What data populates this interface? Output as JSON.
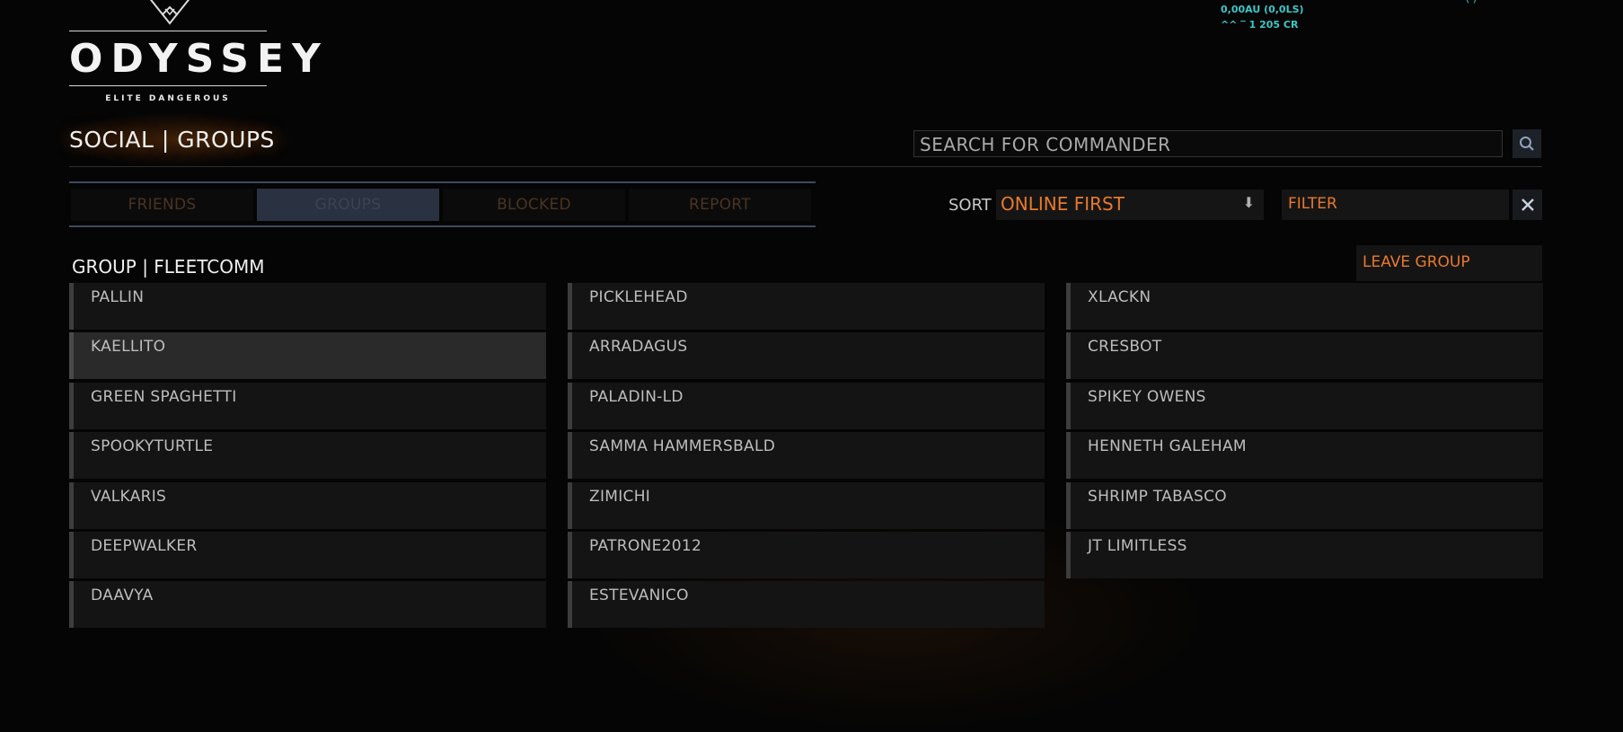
{
  "logo": {
    "title": "ODYSSEY",
    "subtitle": "ELITE DANGEROUS"
  },
  "hud": {
    "line1": "0,00AU (0,0LS)",
    "line2": "^^ ‾ 1 205 CR",
    "corner": "(   )"
  },
  "page_title": "SOCIAL | GROUPS",
  "search": {
    "placeholder": "SEARCH FOR COMMANDER",
    "icon": "search-icon"
  },
  "tabs": [
    {
      "label": "FRIENDS",
      "active": false
    },
    {
      "label": "GROUPS",
      "active": true
    },
    {
      "label": "BLOCKED",
      "active": false
    },
    {
      "label": "REPORT",
      "active": false
    }
  ],
  "sort": {
    "label": "SORT",
    "value": "ONLINE FIRST",
    "icon": "sort-arrow-icon"
  },
  "filter": {
    "placeholder": "FILTER",
    "clear_icon": "close-icon"
  },
  "group": {
    "title": "GROUP | FLEETCOMM",
    "leave_label": "LEAVE GROUP",
    "columns": [
      [
        "PALLIN",
        "KAELLITO",
        "GREEN SPAGHETTI",
        "SPOOKYTURTLE",
        "VALKARIS",
        "DEEPWALKER",
        "DAAVYA"
      ],
      [
        "PICKLEHEAD",
        "ARRADAGUS",
        "PALADIN-LD",
        "SAMMA HAMMERSBALD",
        "ZIMICHI",
        "PATRONE2012",
        "ESTEVANICO"
      ],
      [
        "XLACKN",
        "CRESBOT",
        "SPIKEY OWENS",
        "HENNETH GALEHAM",
        "SHRIMP TABASCO",
        "JT LIMITLESS"
      ]
    ],
    "highlighted": "KAELLITO"
  },
  "colors": {
    "accent": "#e8792c",
    "hud": "#3fc6c6",
    "tab_active_bg": "#2a3140",
    "row_bg": "#141414"
  }
}
